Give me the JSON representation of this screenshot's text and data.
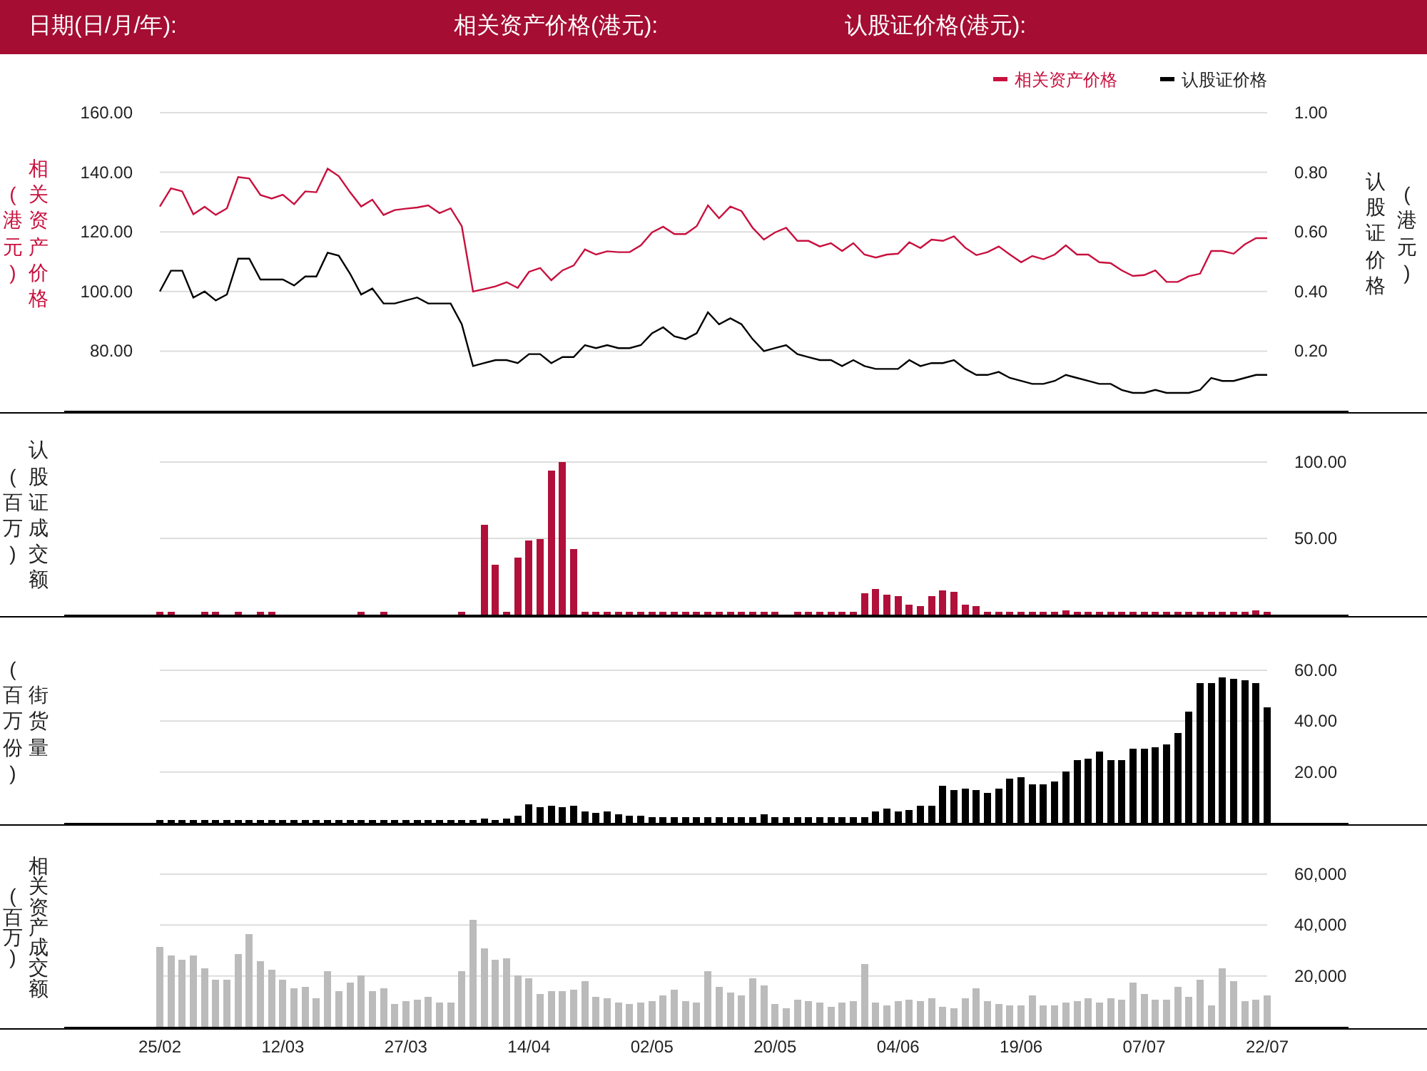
{
  "header": {
    "fields": [
      {
        "label": "日期(日/月/年):"
      },
      {
        "label": "相关资产价格(港元):"
      },
      {
        "label": "认股证价格(港元):"
      }
    ]
  },
  "panels": [
    {
      "kind": "line",
      "left_axis": {
        "label": "相关资产价格",
        "unit": "(港元)"
      },
      "right_axis": {
        "label": "认股证价格",
        "unit": "(港元)"
      },
      "chart_data": {
        "type": "line",
        "grid": true,
        "legend": true,
        "ylim": [
          60,
          160
        ],
        "y2lim": [
          0,
          1
        ],
        "y2ticks": [
          {
            "value": 0.2,
            "label": "0.20"
          },
          {
            "value": 0.4,
            "label": "0.40"
          },
          {
            "value": 0.6,
            "label": "0.60"
          },
          {
            "value": 0.8,
            "label": "0.80"
          },
          {
            "value": 1,
            "label": "1.00"
          }
        ],
        "yticks": [
          {
            "value": 80,
            "label": "80.00"
          },
          {
            "value": 100,
            "label": "100.00"
          },
          {
            "value": 120,
            "label": "120.00"
          },
          {
            "value": 140,
            "label": "140.00"
          },
          {
            "value": 160,
            "label": "160.00"
          }
        ],
        "series": [
          {
            "name": "相关资产价格",
            "color": "#c8103e",
            "values": [
              128.5,
              134.6,
              133.6,
              125.9,
              128.4,
              125.7,
              127.9,
              138.4,
              137.9,
              132.4,
              131.2,
              132.5,
              129.3,
              133.6,
              133.3,
              141.2,
              138.7,
              133.3,
              128.5,
              130.8,
              125.7,
              127.3,
              127.8,
              128.2,
              128.9,
              126.3,
              127.9,
              121.9,
              100.0,
              100.8,
              101.7,
              103.1,
              101.2,
              106.6,
              107.9,
              103.8,
              107.1,
              108.7,
              114.1,
              112.4,
              113.5,
              113.2,
              113.2,
              115.5,
              119.8,
              121.7,
              119.3,
              119.3,
              121.9,
              128.9,
              124.6,
              128.5,
              127.0,
              121.4,
              117.4,
              119.8,
              121.4,
              117.0,
              117.0,
              115.1,
              116.2,
              113.6,
              116.2,
              112.4,
              111.4,
              112.4,
              112.7,
              116.5,
              114.6,
              117.4,
              117.0,
              118.5,
              114.7,
              112.2,
              113.2,
              115.1,
              112.4,
              109.8,
              111.9,
              110.8,
              112.4,
              115.5,
              112.4,
              112.4,
              109.8,
              109.5,
              107.1,
              105.2,
              105.5,
              107.1,
              103.2,
              103.2,
              105.1,
              106.0,
              113.6,
              113.6,
              112.7,
              115.8,
              117.9,
              117.9
            ]
          },
          {
            "name": "认股证价格",
            "color": "#000000",
            "axis": "y2",
            "values": [
              0.4,
              0.47,
              0.47,
              0.38,
              0.4,
              0.37,
              0.39,
              0.51,
              0.51,
              0.44,
              0.44,
              0.44,
              0.42,
              0.45,
              0.45,
              0.53,
              0.52,
              0.46,
              0.39,
              0.41,
              0.36,
              0.36,
              0.37,
              0.38,
              0.36,
              0.36,
              0.36,
              0.29,
              0.15,
              0.16,
              0.17,
              0.17,
              0.16,
              0.19,
              0.19,
              0.16,
              0.18,
              0.18,
              0.22,
              0.21,
              0.22,
              0.21,
              0.21,
              0.22,
              0.26,
              0.28,
              0.25,
              0.24,
              0.26,
              0.33,
              0.29,
              0.31,
              0.29,
              0.24,
              0.2,
              0.21,
              0.22,
              0.19,
              0.18,
              0.17,
              0.17,
              0.15,
              0.17,
              0.15,
              0.14,
              0.14,
              0.14,
              0.17,
              0.15,
              0.16,
              0.16,
              0.17,
              0.14,
              0.12,
              0.12,
              0.13,
              0.11,
              0.1,
              0.09,
              0.09,
              0.1,
              0.12,
              0.11,
              0.1,
              0.09,
              0.09,
              0.07,
              0.06,
              0.06,
              0.07,
              0.06,
              0.06,
              0.06,
              0.07,
              0.11,
              0.1,
              0.1,
              0.11,
              0.12,
              0.12
            ]
          }
        ]
      }
    },
    {
      "kind": "bar",
      "left_axis": {
        "label": "认股证成交额",
        "unit": "(百万)"
      },
      "chart_data": {
        "type": "bar",
        "grid": true,
        "ylim": [
          0,
          100
        ],
        "yticks": [
          {
            "value": 50,
            "label": "50.00"
          },
          {
            "value": 100,
            "label": "100.00"
          }
        ],
        "series": [
          {
            "color": "#b0103a",
            "values": [
              2,
              2,
              0,
              0,
              2,
              2,
              0,
              2,
              0,
              2,
              2,
              0,
              0,
              0,
              0,
              0,
              0,
              0,
              2,
              0,
              2,
              0,
              0,
              0,
              0,
              0,
              0,
              2,
              0,
              59,
              33,
              2,
              37,
              49,
              50,
              94,
              100,
              43,
              2,
              2,
              2,
              2,
              2,
              2,
              2,
              2,
              2,
              2,
              2,
              2,
              2,
              2,
              2,
              2,
              2,
              2,
              0,
              2,
              2,
              2,
              2,
              2,
              2,
              14,
              17,
              13,
              12,
              7,
              6,
              12,
              16,
              15,
              7,
              6,
              2,
              2,
              2,
              2,
              2,
              2,
              2,
              3,
              2,
              2,
              2,
              2,
              2,
              2,
              2,
              2,
              2,
              2,
              2,
              2,
              2,
              2,
              2,
              2,
              3,
              2
            ]
          }
        ]
      }
    },
    {
      "kind": "bar",
      "left_axis": {
        "label": "街货量",
        "unit": "(百万份)"
      },
      "chart_data": {
        "type": "bar",
        "grid": true,
        "ylim": [
          0,
          60
        ],
        "yticks": [
          {
            "value": 20,
            "label": "20.00"
          },
          {
            "value": 40,
            "label": "40.00"
          },
          {
            "value": 60,
            "label": "60.00"
          }
        ],
        "series": [
          {
            "color": "#000000",
            "values": [
              1,
              1,
              1,
              1,
              1,
              1,
              1,
              1,
              1,
              1,
              1,
              1,
              1,
              1,
              1,
              1,
              1,
              1,
              1,
              1,
              1,
              1,
              1,
              1,
              1,
              1,
              1,
              1,
              1,
              1.5,
              1,
              1.7,
              2.8,
              7.2,
              6.1,
              6.7,
              6.1,
              6.7,
              4.4,
              3.9,
              4.4,
              3.3,
              2.8,
              2.8,
              2.2,
              2.2,
              2.2,
              2.2,
              2.2,
              2.2,
              2.2,
              2.2,
              2.2,
              2.2,
              3.5,
              2.2,
              2.2,
              2.2,
              2.2,
              2.2,
              2.2,
              2.2,
              2.2,
              2.2,
              4.5,
              5.5,
              4.4,
              5,
              7,
              7,
              14.4,
              12.8,
              13.3,
              12.8,
              11.7,
              13.3,
              17.2,
              17.8,
              15,
              15,
              16,
              20,
              24.4,
              25,
              27.8,
              24.4,
              24.4,
              28.9,
              28.9,
              30,
              30.6,
              35.6,
              43.9,
              55,
              55,
              57.2,
              56.7,
              56.1,
              55,
              45.6
            ]
          }
        ]
      }
    },
    {
      "kind": "bar",
      "left_axis": {
        "label": "相关资产成交额",
        "unit": "(百万)"
      },
      "chart_data": {
        "type": "bar",
        "grid": true,
        "ylim": [
          0,
          60000
        ],
        "yticks": [
          {
            "value": 20000,
            "label": "20,000"
          },
          {
            "value": 40000,
            "label": "40,000"
          },
          {
            "value": 60000,
            "label": "60,000"
          }
        ],
        "series": [
          {
            "color": "#bbbbbb",
            "values": [
              31400,
              28000,
              26200,
              28000,
              22800,
              18600,
              18600,
              28700,
              36300,
              25600,
              22400,
              18600,
              15100,
              15800,
              11300,
              22100,
              13800,
              17600,
              20000,
              13800,
              15100,
              9200,
              9900,
              10600,
              11700,
              9600,
              9600,
              21700,
              42200,
              30800,
              26600,
              26900,
              20000,
              19300,
              13000,
              14100,
              14100,
              14800,
              17900,
              12000,
              11300,
              9600,
              9200,
              9600,
              10300,
              12400,
              14400,
              10300,
              9600,
              21700,
              15800,
              13400,
              12400,
              19300,
              16500,
              8900,
              7200,
              10600,
              9900,
              9600,
              7800,
              9600,
              9900,
              24500,
              9600,
              8200,
              10300,
              10600,
              9900,
              11300,
              7800,
              7500,
              11000,
              15100,
              9900,
              8900,
              8600,
              8200,
              12400,
              8200,
              8200,
              9600,
              10300,
              11300,
              9600,
              11300,
              10600,
              17600,
              13000,
              10600,
              10600,
              15500,
              11700,
              18600,
              8200,
              22800,
              18000,
              9900,
              10600,
              12400
            ]
          }
        ]
      }
    }
  ],
  "x_axis": {
    "labels": [
      "25/02",
      "12/03",
      "27/03",
      "14/04",
      "02/05",
      "20/05",
      "04/06",
      "19/06",
      "07/07",
      "22/07"
    ]
  }
}
